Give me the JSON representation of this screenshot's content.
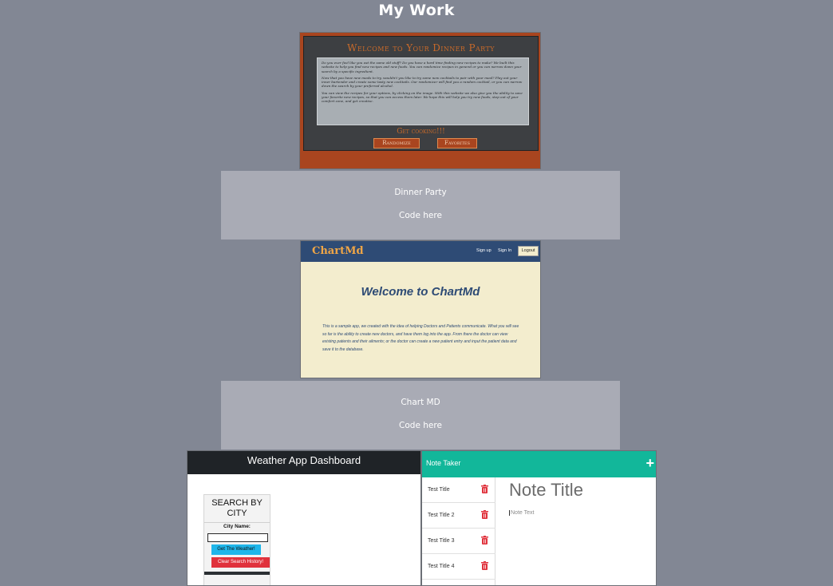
{
  "page": {
    "title": "My Work"
  },
  "projects": [
    {
      "name": "Dinner Party",
      "code_link": "Code here",
      "screenshot": {
        "title": "Welcome to Your Dinner Party",
        "paragraphs": [
          "Do you ever feel like you eat the same old stuff? Do you have a hard time finding new recipes to make? We built this website to help you find new recipes and new foods. You can randomize recipes in general or you can narrow down your search by a specific ingredient.",
          "Now that you have new meals to try, wouldn't you like to try some new cocktails to pair with your meal? Play out your inner bartender and create some tasty new cocktails. Our randomizer will find you a random cocktail, or you can narrow down the search by your preferred alcohol.",
          "You can view the recipes for your options, by clicking on the image. With this website we also give you the ability to save your favorite new recipes, so that you can access them later. We hope this will help you try new foods, step out of your comfort zone, and get creative."
        ],
        "call_to_action": "Get cooking!!!",
        "randomize_label": "Randomize",
        "favorites_label": "Favorites",
        "colors": {
          "background": "#a9451f",
          "panel": "#3d3f42",
          "accent": "#c96a2a"
        }
      }
    },
    {
      "name": "Chart MD",
      "code_link": "Code here",
      "screenshot": {
        "brand": "ChartMd",
        "nav": {
          "signup": "Sign up",
          "signin": "Sign In",
          "logout": "Logout"
        },
        "heading": "Welcome to ChartMd",
        "description": "This is a sample app, we created with the idea of helping Doctors and Patients communicate. What you will see so far is the ability to create new doctors, and have them log into the app. From there the doctor can view existing patients and their ailments; or the doctor can create a new patient entry and input the patient data and save it to the database.",
        "colors": {
          "nav": "#2e4b75",
          "brand": "#f0a646",
          "background": "#f3edce"
        }
      }
    }
  ],
  "weather": {
    "title": "Weather App Dashboard",
    "search_title": "SEARCH BY CITY",
    "city_label": "City Name:",
    "city_value": "",
    "get_weather_label": "Get The Weather!",
    "clear_history_label": "Clear Search History!",
    "colors": {
      "header": "#1f2327",
      "get_button": "#1fb6ea",
      "clear_button": "#e0323c"
    }
  },
  "notes": {
    "title": "Note Taker",
    "add_icon": "plus-icon",
    "items": [
      "Test Title",
      "Test Title 2",
      "Test Title 3",
      "Test Title 4"
    ],
    "note_title_placeholder": "Note Title",
    "note_text_placeholder": "Note Text",
    "delete_icon": "trash-icon",
    "colors": {
      "header": "#12b79a",
      "delete": "#e0323c"
    }
  }
}
